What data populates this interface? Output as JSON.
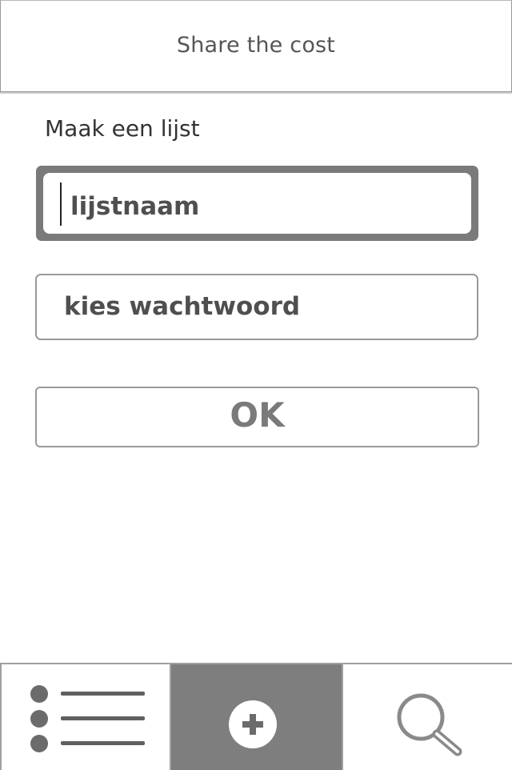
{
  "header": {
    "title": "Share the cost"
  },
  "main": {
    "section_title": "Maak een lijst",
    "list_name_field": {
      "placeholder": "lijstnaam",
      "value": ""
    },
    "password_field": {
      "placeholder": "kies wachtwoord",
      "value": ""
    },
    "ok_label": "OK"
  },
  "tabbar": {
    "items": [
      {
        "icon": "list-icon",
        "selected": false
      },
      {
        "icon": "plus-circle-icon",
        "selected": true
      },
      {
        "icon": "search-icon",
        "selected": false
      }
    ]
  },
  "colors": {
    "active_tab_background": "#7e7e7e",
    "focused_field_border": "#7a7a7a",
    "border": "#999999",
    "text": "#333333"
  }
}
